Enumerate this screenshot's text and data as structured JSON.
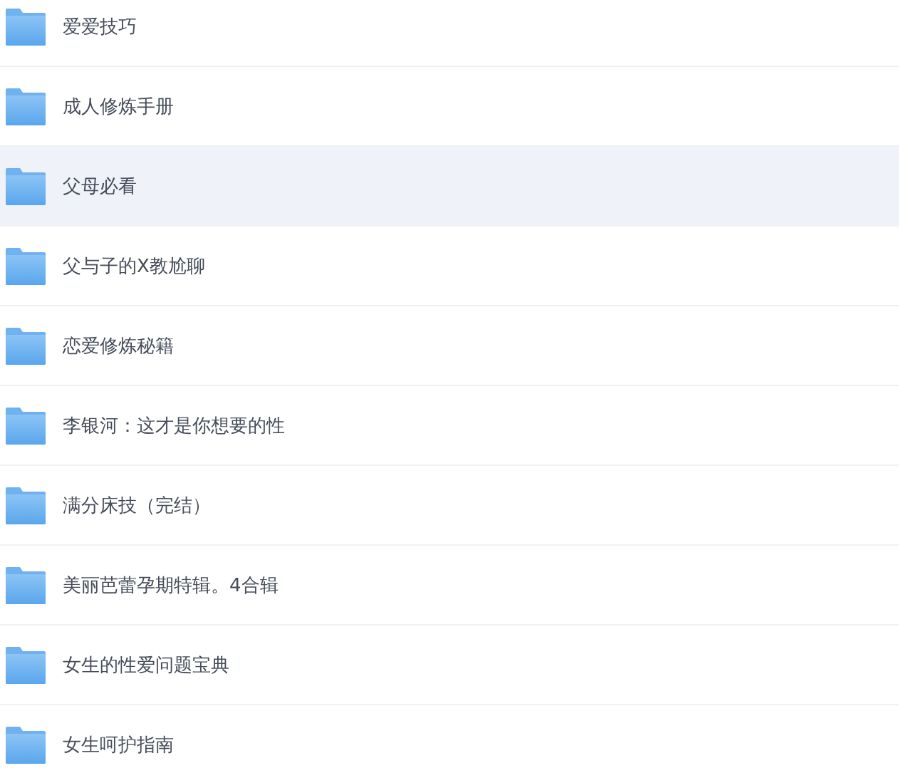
{
  "folders": [
    {
      "name": "爱爱技巧",
      "selected": false
    },
    {
      "name": "成人修炼手册",
      "selected": false
    },
    {
      "name": "父母必看",
      "selected": true
    },
    {
      "name": "父与子的X教尬聊",
      "selected": false
    },
    {
      "name": "恋爱修炼秘籍",
      "selected": false
    },
    {
      "name": "李银河：这才是你想要的性",
      "selected": false
    },
    {
      "name": "满分床技（完结）",
      "selected": false
    },
    {
      "name": "美丽芭蕾孕期特辑。4合辑",
      "selected": false
    },
    {
      "name": "女生的性爱问题宝典",
      "selected": false
    },
    {
      "name": "女生呵护指南",
      "selected": false
    }
  ]
}
